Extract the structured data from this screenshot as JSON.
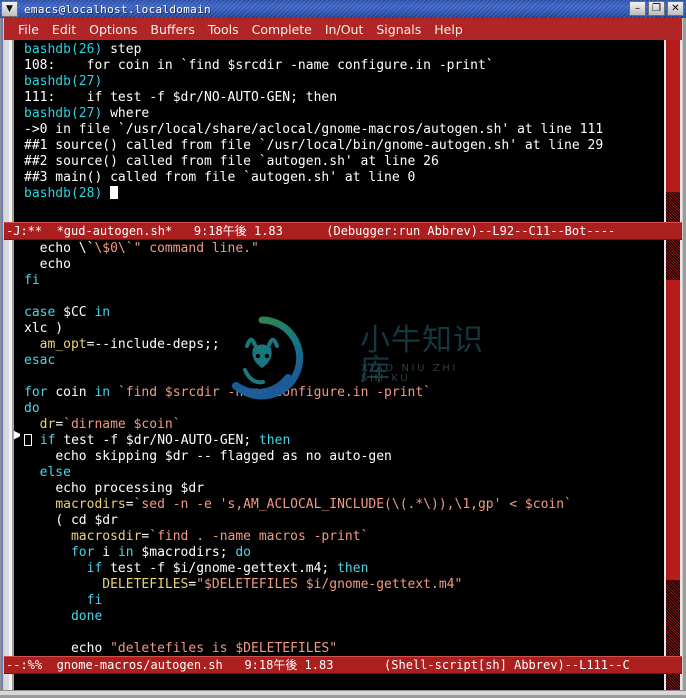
{
  "window": {
    "title": "emacs@localhost.localdomain",
    "menu_button_icon": "window-menu-chevron-icon",
    "minimize_label": "–",
    "maximize_label": "❐",
    "close_label": "✕"
  },
  "menubar": {
    "items": [
      {
        "label": "File"
      },
      {
        "label": "Edit"
      },
      {
        "label": "Options"
      },
      {
        "label": "Buffers"
      },
      {
        "label": "Tools"
      },
      {
        "label": "Complete"
      },
      {
        "label": "In/Out"
      },
      {
        "label": "Signals"
      },
      {
        "label": "Help"
      }
    ]
  },
  "top_window": {
    "buffer_name": "*gud-autogen.sh*",
    "lines": [
      "bashdb(26) step",
      "108:    for coin in `find $srcdir -name configure.in -print`",
      "bashdb(27)",
      "111:    if test -f $dr/NO-AUTO-GEN; then",
      "bashdb(27) where",
      "->0 in file `/usr/local/share/aclocal/gnome-macros/autogen.sh' at line 111",
      "##1 source() called from file `/usr/local/bin/gnome-autogen.sh' at line 29",
      "##2 source() called from file `autogen.sh' at line 26",
      "##3 main() called from file `autogen.sh' at line 0",
      "bashdb(28) "
    ],
    "modeline": {
      "flags": "-J:**",
      "buffer": "*gud-autogen.sh*",
      "time": "9:18午後 1.83",
      "modes": "(Debugger:run Abbrev)--L92--C11--Bot----"
    }
  },
  "bottom_window": {
    "buffer_name": "gnome-macros/autogen.sh",
    "lines": [
      "  echo \\\"$0\\\"\" command line.\"",
      "  echo",
      "fi",
      "",
      "case $CC in",
      "xlc )",
      "  am_opt=--include-deps;;",
      "esac",
      "",
      "for coin in `find $srcdir -name configure.in -print`",
      "do",
      "  dr=`dirname $coin`",
      "  if test -f $dr/NO-AUTO-GEN; then",
      "    echo skipping $dr -- flagged as no auto-gen",
      "  else",
      "    echo processing $dr",
      "    macrodirs=`sed -n -e 's,AM_ACLOCAL_INCLUDE(\\(.*\\)),\\1,gp' < $coin`",
      "    ( cd $dr",
      "      macrosdir=`find . -name macros -print`",
      "      for i in $macrodirs; do",
      "        if test -f $i/gnome-gettext.m4; then",
      "          DELETEFILES=\"$DELETEFILES $i/gnome-gettext.m4\"",
      "        fi",
      "      done",
      "",
      "      echo \"deletefiles is $DELETEFILES\""
    ],
    "modeline": {
      "flags": "--:%%",
      "buffer": "gnome-macros/autogen.sh",
      "time": "9:18午後 1.83",
      "modes": "(Shell-script[sh] Abbrev)--L111--C"
    }
  },
  "watermark": {
    "text": "小牛知识库",
    "subtitle": "XIAO NIU ZHI SHI KU",
    "logo_icon": "ox-head-circle-logo"
  },
  "colors": {
    "modeline_bg": "#ab1f1f",
    "menubar_bg": "#b02626",
    "titlebar_blue": "#2b4fa8",
    "terminal_bg": "#000000",
    "keyword": "#49d5e8",
    "string": "#f09a82",
    "variable": "#e8d27a",
    "prompt": "#21d6e0",
    "foreground": "#ffffff"
  }
}
